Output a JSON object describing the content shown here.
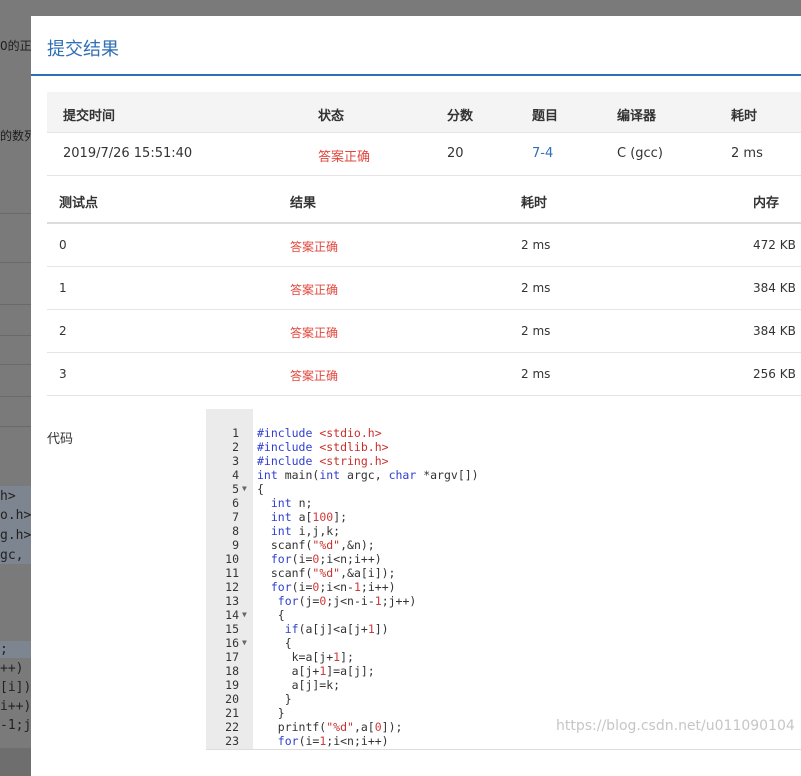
{
  "modal": {
    "title": "提交结果"
  },
  "summary": {
    "headers": [
      "提交时间",
      "状态",
      "分数",
      "题目",
      "编译器",
      "耗时"
    ],
    "row": {
      "time": "2019/7/26 15:51:40",
      "status": "答案正确",
      "score": "20",
      "problem": "7-4",
      "compiler": "C (gcc)",
      "duration": "2 ms"
    }
  },
  "cases": {
    "headers": [
      "测试点",
      "结果",
      "耗时",
      "内存"
    ],
    "rows": [
      {
        "id": "0",
        "result": "答案正确",
        "time": "2 ms",
        "memory": "472 KB"
      },
      {
        "id": "1",
        "result": "答案正确",
        "time": "2 ms",
        "memory": "384 KB"
      },
      {
        "id": "2",
        "result": "答案正确",
        "time": "2 ms",
        "memory": "384 KB"
      },
      {
        "id": "3",
        "result": "答案正确",
        "time": "2 ms",
        "memory": "256 KB"
      }
    ]
  },
  "code": {
    "label": "代码",
    "lines": [
      "#include <stdio.h>",
      "#include <stdlib.h>",
      "#include <string.h>",
      "int main(int argc, char *argv[])",
      "{",
      "  int n;",
      "  int a[100];",
      "  int i,j,k;",
      "  scanf(\"%d\",&n);",
      "  for(i=0;i<n;i++)",
      "  scanf(\"%d\",&a[i]);",
      "  for(i=0;i<n-1;i++)",
      "   for(j=0;j<n-i-1;j++)",
      "   {",
      "    if(a[j]<a[j+1])",
      "    {",
      "     k=a[j+1];",
      "     a[j+1]=a[j];",
      "     a[j]=k;",
      "    }",
      "   }",
      "   printf(\"%d\",a[0]);",
      "   for(i=1;i<n;i++)"
    ]
  },
  "background": {
    "fragments": [
      "0的正",
      "的数列"
    ],
    "code_fragments": [
      " h>",
      "o.h>",
      "g.h>",
      "gc, c",
      " ;",
      "++)",
      "[i]);",
      " i++)",
      "-1;j"
    ]
  },
  "watermark": "https://blog.csdn.net/u011090104"
}
